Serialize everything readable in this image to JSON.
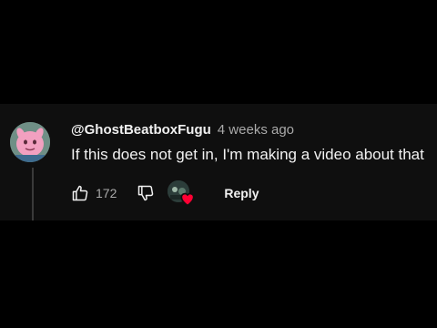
{
  "comment": {
    "author": "@GhostBeatboxFugu",
    "timestamp": "4 weeks ago",
    "text": "If this does not get in, I'm making a video about that",
    "like_count": "172",
    "reply_label": "Reply"
  },
  "icons": {
    "like": "thumbs-up-icon",
    "dislike": "thumbs-down-icon",
    "creator_heart": "heart-icon"
  },
  "colors": {
    "panel_background": "#0f0f0f",
    "primary_text": "#f1f1f1",
    "secondary_text": "#aaaaaa",
    "heart": "#ff0033"
  }
}
